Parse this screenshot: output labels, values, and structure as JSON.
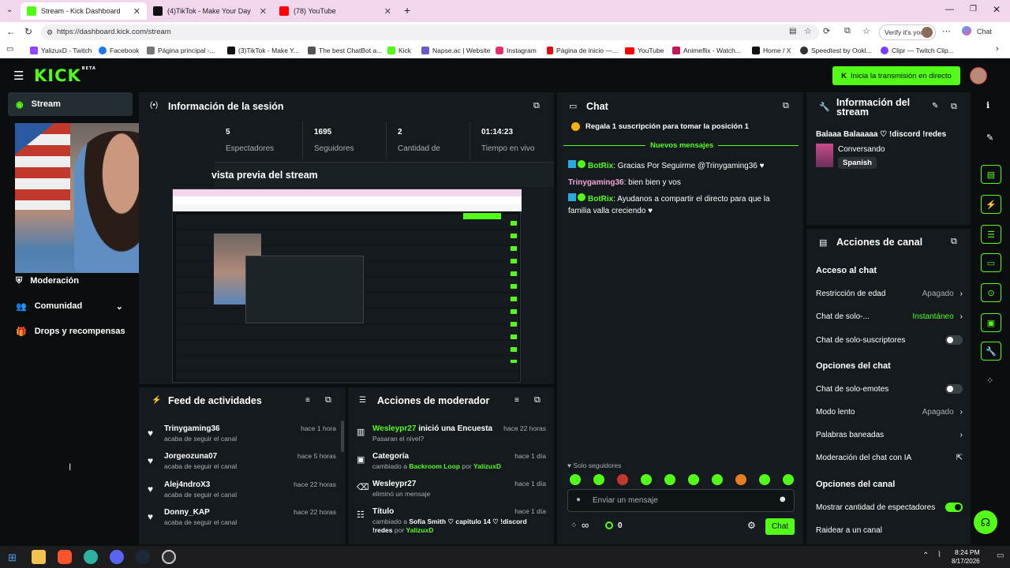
{
  "browser": {
    "tabs": [
      {
        "title": "Stream - Kick Dashboard",
        "color": "#53fc18"
      },
      {
        "title": "(4)TikTok - Make Your Day",
        "color": "#111111"
      },
      {
        "title": "(78) YouTube",
        "color": "#ff0000"
      }
    ],
    "url": "https://dashboard.kick.com/stream",
    "profile_label": "Verify it's you",
    "chat_label": "Chat",
    "bookmarks": [
      "YalizuxD - Twitch",
      "Facebook",
      "Página principal -...",
      "(3)TikTok - Make Y...",
      "The best ChatBot a...",
      "Kick",
      "Napse.ac | Website",
      "Instagram",
      "Página de inicio —...",
      "YouTube",
      "Animeflix - Watch...",
      "Home / X",
      "Speedtest by Ookl...",
      "Clipr — Twitch Clip..."
    ]
  },
  "app": {
    "logo": "KICK",
    "logo_badge": "BETA",
    "go_live": "Inicia la transmisión en directo",
    "nav": [
      {
        "label": "Stream"
      },
      {
        "label": "Moderación"
      },
      {
        "label": "Comunidad"
      },
      {
        "label": "Drops y recompensas"
      }
    ],
    "session": {
      "title": "Información de la sesión",
      "stats": [
        {
          "value": "5",
          "label": "Espectadores"
        },
        {
          "value": "1695",
          "label": "Seguidores"
        },
        {
          "value": "2",
          "label": "Cantidad de"
        },
        {
          "value": "01:14:23",
          "label": "Tiempo en vivo"
        }
      ],
      "preview_title": "vista previa del stream"
    },
    "feed": {
      "title": "Feed de actividades",
      "items": [
        {
          "name": "Trinygaming36",
          "sub": "acaba de seguir el canal",
          "time": "hace 1 hora"
        },
        {
          "name": "Jorgeozuna07",
          "sub": "acaba de seguir el canal",
          "time": "hace 5 horas"
        },
        {
          "name": "Alej4ndroX3",
          "sub": "acaba de seguir el canal",
          "time": "hace 22 horas"
        },
        {
          "name": "Donny_KAP",
          "sub": "acaba de seguir el canal",
          "time": "hace 22 horas"
        }
      ]
    },
    "modactions": {
      "title": "Acciones de moderador",
      "items": [
        {
          "name": "Wesleypr27",
          "action": "inició una Encuesta",
          "sub": "Pasaran el nivel?",
          "time": "hace 22 horas"
        },
        {
          "name": "Categoría",
          "sub_pre": "cambiado a ",
          "sub_hl": "Backroom Loop",
          "sub_by": " por ",
          "sub_user": "YalizuxD",
          "time": "hace 1 día"
        },
        {
          "name": "Wesleypr27",
          "sub": "eliminó un mensaje",
          "time": "hace 1 día"
        },
        {
          "name": "Título",
          "sub_pre": "cambiado a ",
          "sub_hl": "Sofia Smith ♡ capitulo 14 ♡ !discord !redes",
          "sub_by": " por ",
          "sub_user": "YalizuxD",
          "time": "hace 1 día"
        }
      ]
    },
    "chat": {
      "title": "Chat",
      "pinned": "Regala 1 suscripción para tomar la posición 1",
      "new_messages": "Nuevos mensajes",
      "messages": [
        {
          "user": "BotRix",
          "text": ": Gracias Por Seguirme @Trinygaming36 ♥",
          "user_color": "#53fc18"
        },
        {
          "user": "Trinygaming36",
          "text": ": bien bien y vos",
          "user_color": "#f2a6d8"
        },
        {
          "user": "BotRix",
          "text": ": Ayudanos a compartir el directo para que la familia valla creciendo ♥",
          "user_color": "#53fc18"
        }
      ],
      "followers_only": "Solo seguidores",
      "placeholder": "Enviar un mensaje",
      "infinity": "∞",
      "points": "0",
      "send": "Chat"
    },
    "stream_info": {
      "title_line1": "Información del",
      "title_line2": "stream",
      "stream_title": "Balaaa Balaaaaa ♡ !discord !redes",
      "category": "Conversando",
      "language": "Spanish"
    },
    "channel_actions": {
      "title": "Acciones de canal",
      "sec1": "Acceso al chat",
      "age": "Restricción de edad",
      "age_val": "Apagado",
      "followers_chat": "Chat de solo-...",
      "followers_val": "Instantáneo",
      "subs_chat": "Chat de solo-suscriptores",
      "sec2": "Opciones del chat",
      "emotes": "Chat de solo-emotes",
      "slow": "Modo lento",
      "slow_val": "Apagado",
      "banned": "Palabras baneadas",
      "ai_mod": "Moderación del chat con IA",
      "sec3": "Opciones del canal",
      "show_viewers": "Mostrar cantidad de espectadores",
      "raid": "Raidear a un canal"
    },
    "colors": {
      "accent": "#53fc18",
      "panel": "#141a1d",
      "bg": "#0b0e0f"
    }
  },
  "taskbar": {
    "time": "8:24 PM",
    "date": "8/17/2026"
  }
}
